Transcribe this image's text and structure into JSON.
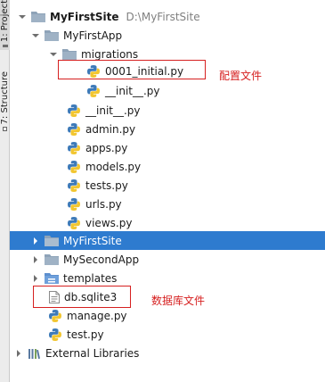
{
  "side_tabs": {
    "project_label": "1: Project",
    "structure_label": "7: Structure"
  },
  "tree": {
    "root": {
      "label": "MyFirstSite",
      "path": "D:\\MyFirstSite"
    },
    "app_folder": {
      "label": "MyFirstApp"
    },
    "migrations_folder": {
      "label": "migrations"
    },
    "migration_initial": {
      "label": "0001_initial.py"
    },
    "migrations_init": {
      "label": "__init__.py"
    },
    "app_init": {
      "label": "__init__.py"
    },
    "admin": {
      "label": "admin.py"
    },
    "apps": {
      "label": "apps.py"
    },
    "models": {
      "label": "models.py"
    },
    "tests": {
      "label": "tests.py"
    },
    "urls": {
      "label": "urls.py"
    },
    "views": {
      "label": "views.py"
    },
    "site_folder": {
      "label": "MyFirstSite"
    },
    "second_app_folder": {
      "label": "MySecondApp"
    },
    "templates_folder": {
      "label": "templates"
    },
    "db": {
      "label": "db.sqlite3"
    },
    "manage": {
      "label": "manage.py"
    },
    "test": {
      "label": "test.py"
    },
    "external_libraries": {
      "label": "External Libraries"
    }
  },
  "annotations": {
    "config_file": "配置文件",
    "database_file": "数据库文件"
  },
  "colors": {
    "selection": "#2e7bcf",
    "annotation": "#d62020",
    "folder": "#8ea3b8",
    "folder_blue": "#5d8fce"
  }
}
